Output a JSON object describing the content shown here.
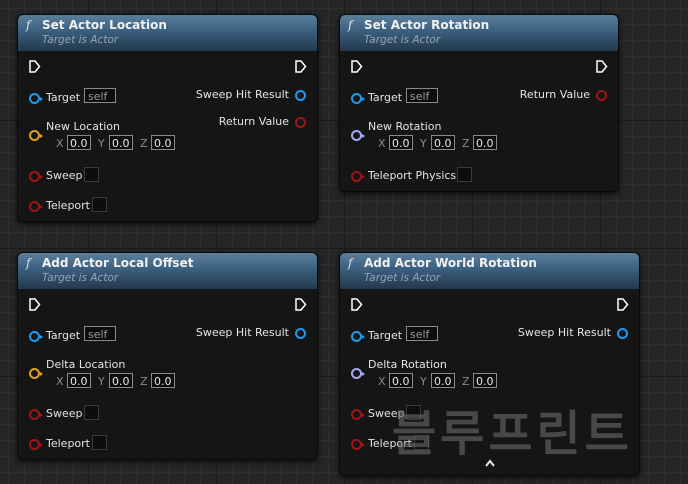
{
  "colors": {
    "exec": "#ffffff",
    "object": "#1d9bf0",
    "vector": "#e0a21a",
    "bool": "#a01419",
    "rotator": "#a8a9f0",
    "header": "#3b5f7e"
  },
  "function_icon": "f",
  "nodes": [
    {
      "title": "Set Actor Location",
      "subtitle": "Target is Actor",
      "target_label": "Target",
      "target_value": "self",
      "vector_label": "New Location",
      "x": "0.0",
      "y": "0.0",
      "z": "0.0",
      "bool_pins": [
        "Sweep",
        "Teleport"
      ],
      "outputs": [
        "Sweep Hit Result",
        "Return Value"
      ]
    },
    {
      "title": "Set Actor Rotation",
      "subtitle": "Target is Actor",
      "target_label": "Target",
      "target_value": "self",
      "vector_label": "New Rotation",
      "x": "0.0",
      "y": "0.0",
      "z": "0.0",
      "bool_pins": [
        "Teleport Physics"
      ],
      "outputs": [
        "Return Value"
      ]
    },
    {
      "title": "Add Actor Local Offset",
      "subtitle": "Target is Actor",
      "target_label": "Target",
      "target_value": "self",
      "vector_label": "Delta Location",
      "x": "0.0",
      "y": "0.0",
      "z": "0.0",
      "bool_pins": [
        "Sweep",
        "Teleport"
      ],
      "outputs": [
        "Sweep Hit Result"
      ]
    },
    {
      "title": "Add Actor World Rotation",
      "subtitle": "Target is Actor",
      "target_label": "Target",
      "target_value": "self",
      "vector_label": "Delta Rotation",
      "x": "0.0",
      "y": "0.0",
      "z": "0.0",
      "bool_pins": [
        "Sweep",
        "Teleport"
      ],
      "outputs": [
        "Sweep Hit Result"
      ]
    }
  ],
  "axis_labels": {
    "x": "X",
    "y": "Y",
    "z": "Z"
  },
  "watermark": "블루프린트"
}
